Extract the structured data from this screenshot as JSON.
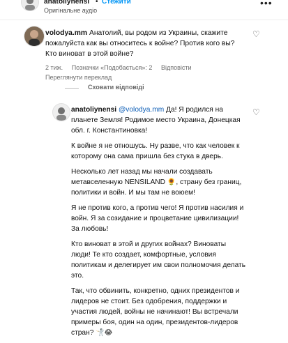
{
  "post_header": {
    "username": "anatoliynensi",
    "separator": "•",
    "follow_label": "Стежити",
    "audio_label": "Оригінальне аудіо",
    "more_icon": "more-horizontal-icon"
  },
  "comment": {
    "username": "volodya.mm",
    "text": "Анатолий, вы родом из Украины, скажите пожалуйста как вы относитесь к войне? Против кого вы? Кто виноват в этой войне?",
    "age": "2 тиж.",
    "likes_label": "Позначки «Подобається»: 2",
    "reply_label": "Відповісти",
    "translate_label": "Переглянути переклад",
    "heart_icon": "heart-outline-icon"
  },
  "replies_toggle": {
    "label": "Сховати відповіді"
  },
  "reply": {
    "username": "anatoliynensi",
    "mention": "@volodya.mm",
    "paragraph_1": "Да! Я родился на планете Земля! Родимое место Украина, Донецкая обл. г. Константиновка!",
    "paragraph_2": "К войне я не отношусь. Ну разве, что как человек к которому она сама пришла без стука в дверь.",
    "paragraph_3": "Несколько лет назад мы начали создавать метавселенную NENSILAND",
    "paragraph_3_emoji": "🌻",
    "paragraph_3_tail": ", страну без границ, политики и войн. И мы там не воюем!",
    "paragraph_4": "Я не против кого, а против чего! Я против насилия и войн. Я за созидание и процветание цивилизации! За любовь!",
    "paragraph_5": "Кто виноват в этой и других войнах? Виноваты люди! Те кто создает, комфортные, условия политикам и делегирует им свои полномочия делать это.",
    "paragraph_6": "Так, что обвинить, конкретно, одних президентов и лидеров не стоит. Без одобрения, поддержки и участия людей, войны не начинают! Вы встречали примеры боя, один на один, президентов-лидеров стран?",
    "paragraph_6_emoji": "🤺😂",
    "heart_icon": "heart-outline-icon"
  }
}
